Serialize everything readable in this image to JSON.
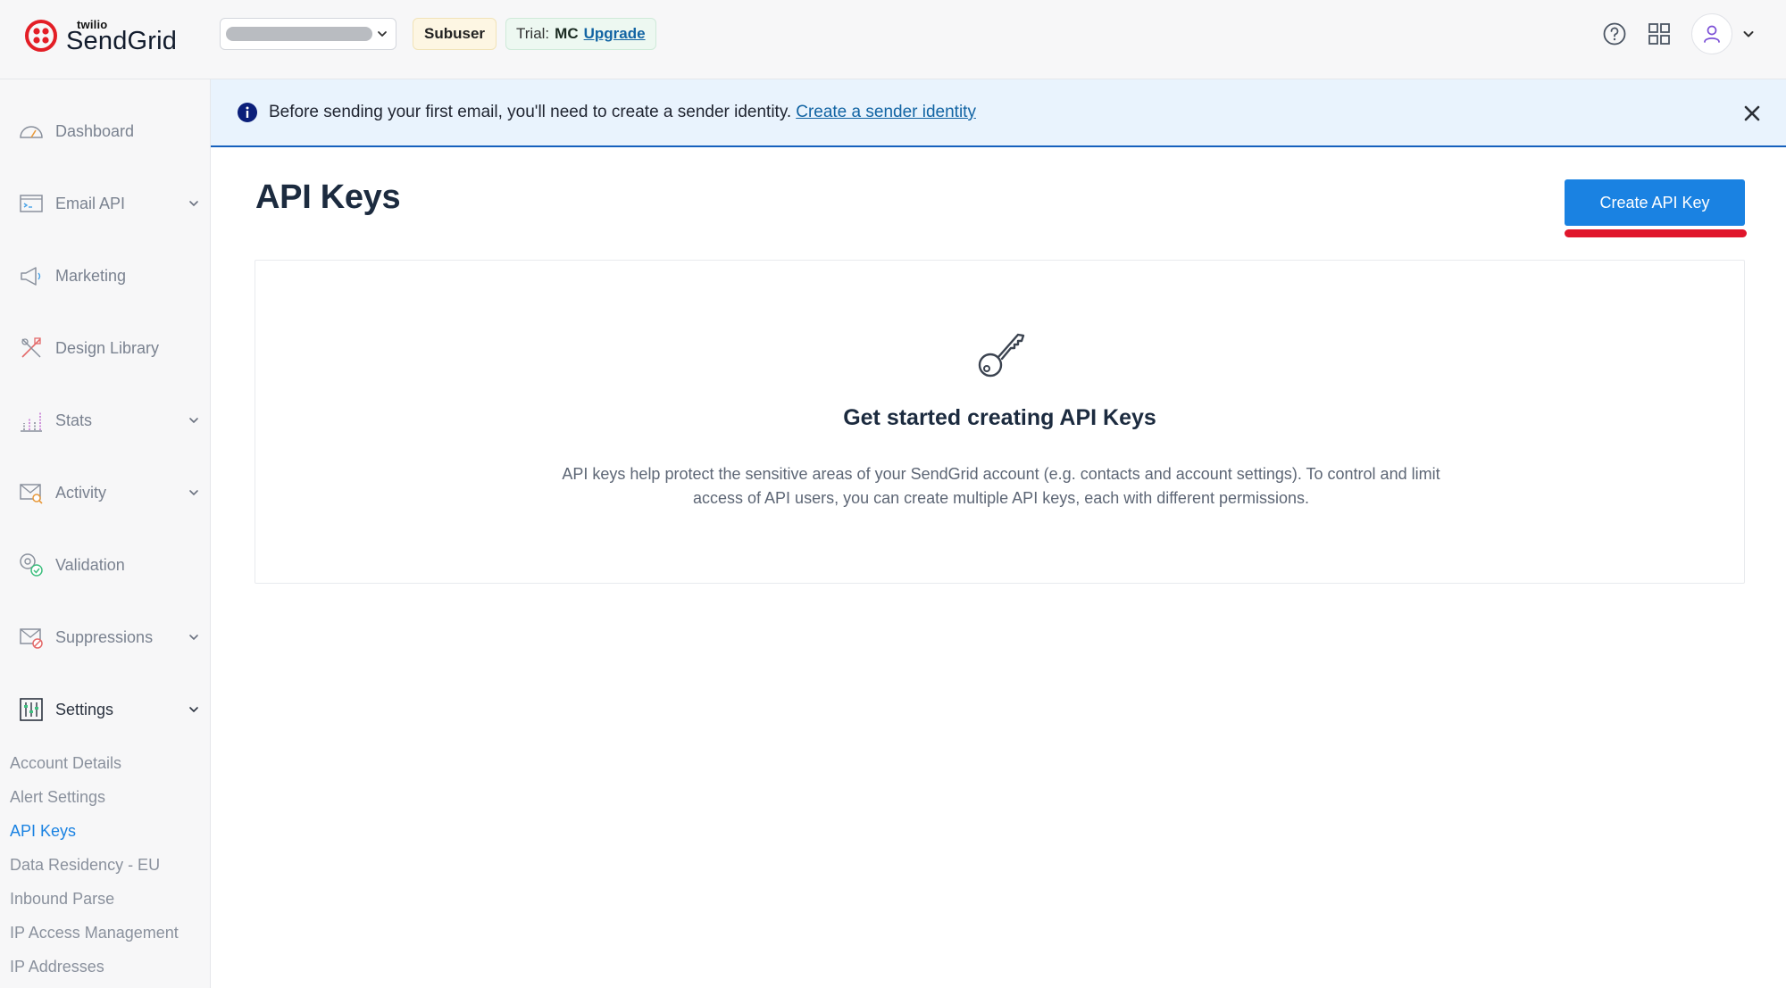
{
  "brand": {
    "small": "twilio",
    "name": "SendGrid",
    "accent": "#e31e26"
  },
  "topbar": {
    "subuser_badge": "Subuser",
    "trial_label": "Trial:",
    "trial_plan": "MC",
    "upgrade_link": "Upgrade",
    "icons": [
      "help-icon",
      "apps-grid-icon",
      "user-icon",
      "chevron-down-icon"
    ]
  },
  "notice": {
    "text": "Before sending your first email, you'll need to create a sender identity.",
    "link": "Create a sender identity"
  },
  "sidebar": {
    "items": [
      {
        "label": "Dashboard",
        "icon": "dashboard-icon"
      },
      {
        "label": "Email API",
        "icon": "email-api-icon"
      },
      {
        "label": "Marketing",
        "icon": "megaphone-icon"
      },
      {
        "label": "Design Library",
        "icon": "design-library-icon"
      },
      {
        "label": "Stats",
        "icon": "stats-icon"
      },
      {
        "label": "Activity",
        "icon": "activity-icon"
      },
      {
        "label": "Validation",
        "icon": "validation-icon"
      },
      {
        "label": "Suppressions",
        "icon": "suppressions-icon"
      },
      {
        "label": "Settings",
        "icon": "settings-icon"
      }
    ],
    "settings_sub": [
      {
        "label": "Account Details"
      },
      {
        "label": "Alert Settings"
      },
      {
        "label": "API Keys",
        "active": true
      },
      {
        "label": "Data Residency - EU"
      },
      {
        "label": "Inbound Parse"
      },
      {
        "label": "IP Access Management"
      },
      {
        "label": "IP Addresses"
      }
    ]
  },
  "main": {
    "title": "API Keys",
    "create_button": "Create API Key",
    "empty_title": "Get started creating API Keys",
    "empty_desc": "API keys help protect the sensitive areas of your SendGrid account (e.g. contacts and account settings). To control and limit access of API users, you can create multiple API keys, each with different permissions."
  },
  "colors": {
    "primary": "#1a82e2",
    "title": "#1c2b3f",
    "banner_bg": "#e9f3fd",
    "annotation_red": "#e0162b"
  }
}
